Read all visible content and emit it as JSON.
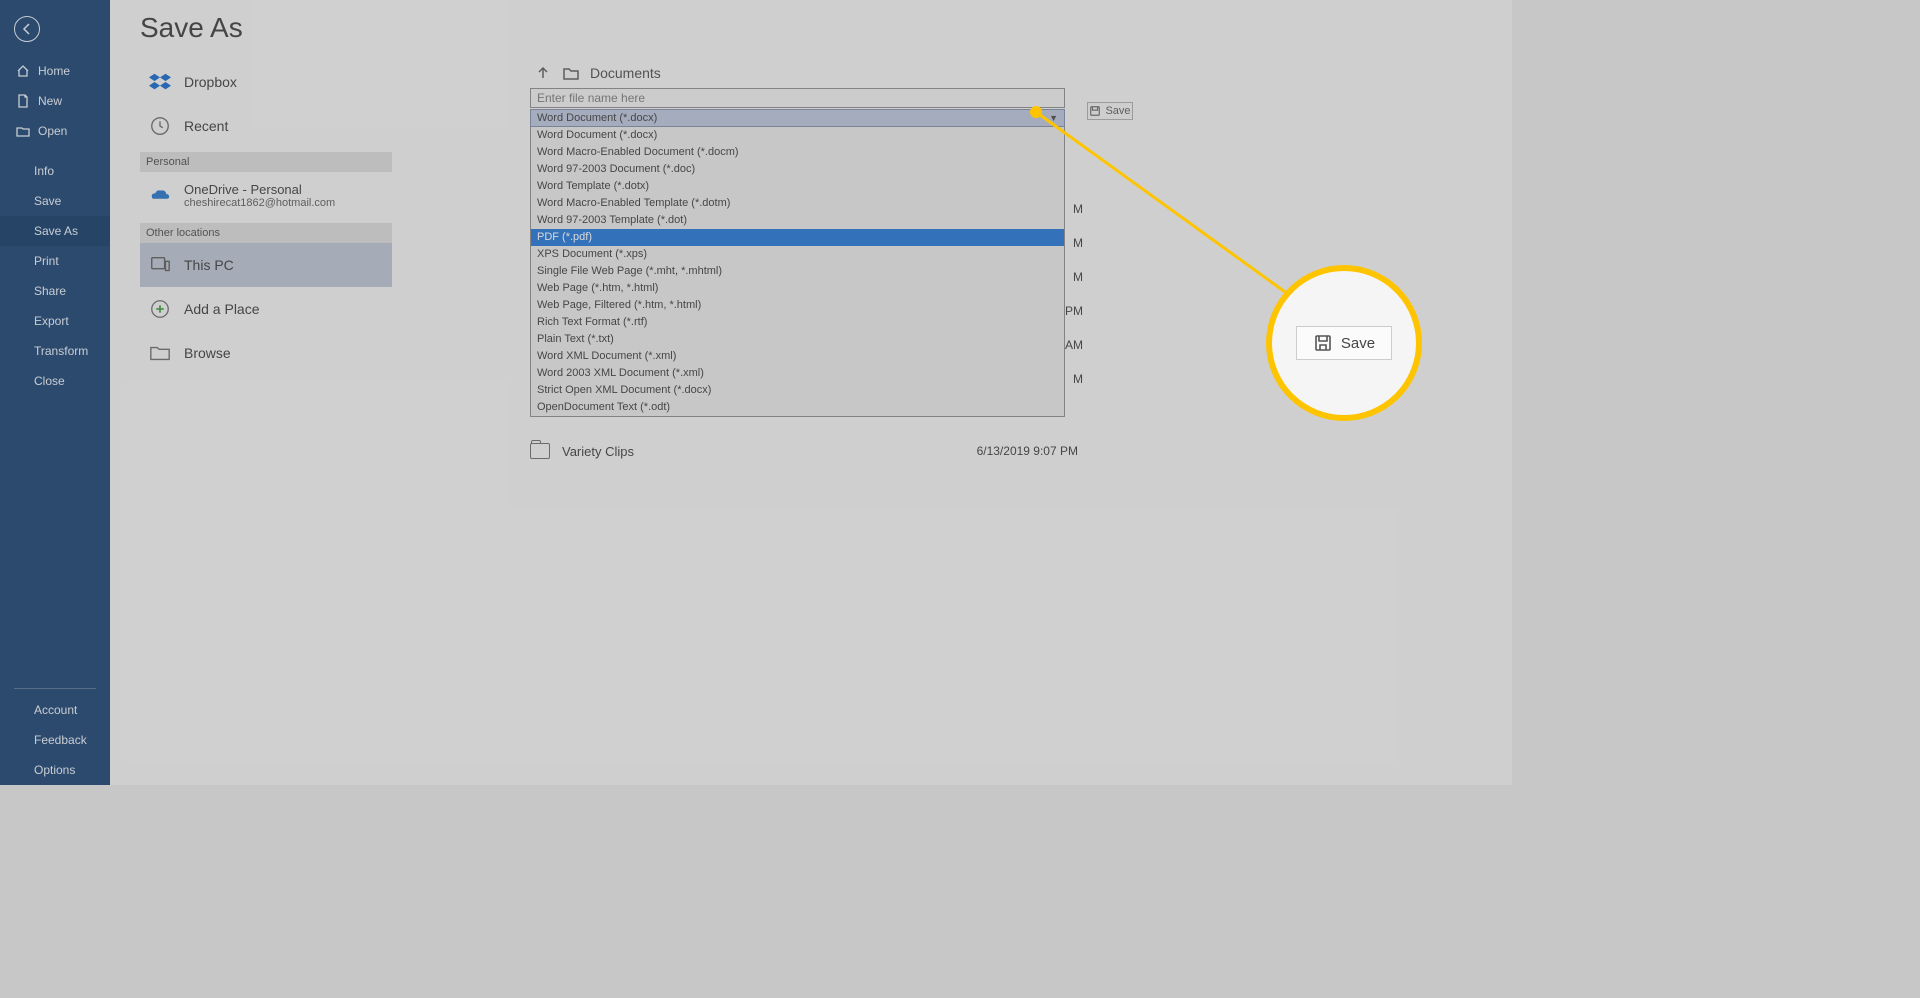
{
  "title": "Save As",
  "sidebar": {
    "home": "Home",
    "new": "New",
    "open": "Open",
    "items": [
      "Info",
      "Save",
      "Save As",
      "Print",
      "Share",
      "Export",
      "Transform",
      "Close"
    ],
    "selected_index": 2,
    "bottom": [
      "Account",
      "Feedback",
      "Options"
    ]
  },
  "places": {
    "dropbox": "Dropbox",
    "recent": "Recent",
    "section_personal": "Personal",
    "onedrive": {
      "title": "OneDrive - Personal",
      "email": "cheshirecat1862@hotmail.com"
    },
    "section_other": "Other locations",
    "thispc": "This PC",
    "addplace": "Add a Place",
    "browse": "Browse"
  },
  "breadcrumb": "Documents",
  "filename_placeholder": "Enter file name here",
  "format_selected": "Word Document (*.docx)",
  "format_options": [
    "Word Document (*.docx)",
    "Word Macro-Enabled Document (*.docm)",
    "Word 97-2003 Document (*.doc)",
    "Word Template (*.dotx)",
    "Word Macro-Enabled Template (*.dotm)",
    "Word 97-2003 Template (*.dot)",
    "PDF (*.pdf)",
    "XPS Document (*.xps)",
    "Single File Web Page (*.mht, *.mhtml)",
    "Web Page (*.htm, *.html)",
    "Web Page, Filtered (*.htm, *.html)",
    "Rich Text Format (*.rtf)",
    "Plain Text (*.txt)",
    "Word XML Document (*.xml)",
    "Word 2003 XML Document (*.xml)",
    "Strict Open XML Document (*.docx)",
    "OpenDocument Text (*.odt)"
  ],
  "format_highlight_index": 6,
  "save_label": "Save",
  "save_label_big": "Save",
  "date_fragments": [
    "M",
    "M",
    "M",
    "PM",
    "AM",
    "M"
  ],
  "file_row": {
    "name": "Variety Clips",
    "date": "6/13/2019 9:07 PM"
  }
}
